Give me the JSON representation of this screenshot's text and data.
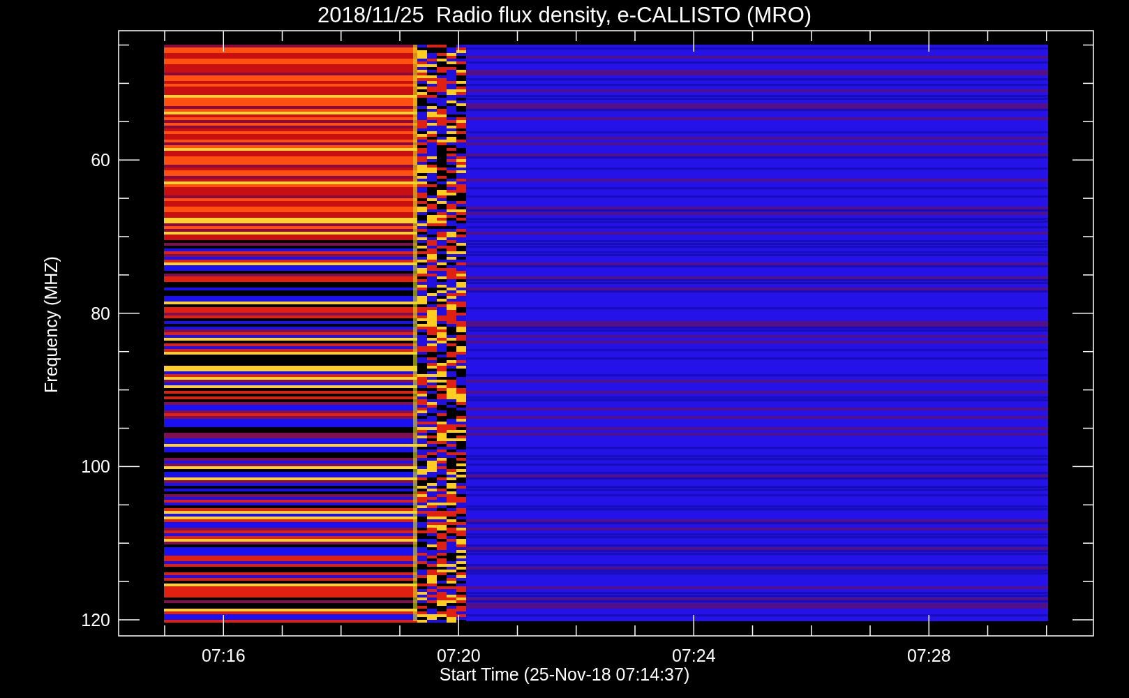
{
  "title": "2018/11/25  Radio flux density, e-CALLISTO (MRO)",
  "y_axis": {
    "label": "Frequency (MHZ)",
    "ticks": [
      "60",
      "80",
      "100",
      "120"
    ]
  },
  "x_axis": {
    "label": "Start Time (25-Nov-18 07:14:37)",
    "ticks": [
      "07:16",
      "07:20",
      "07:24",
      "07:28"
    ]
  }
}
